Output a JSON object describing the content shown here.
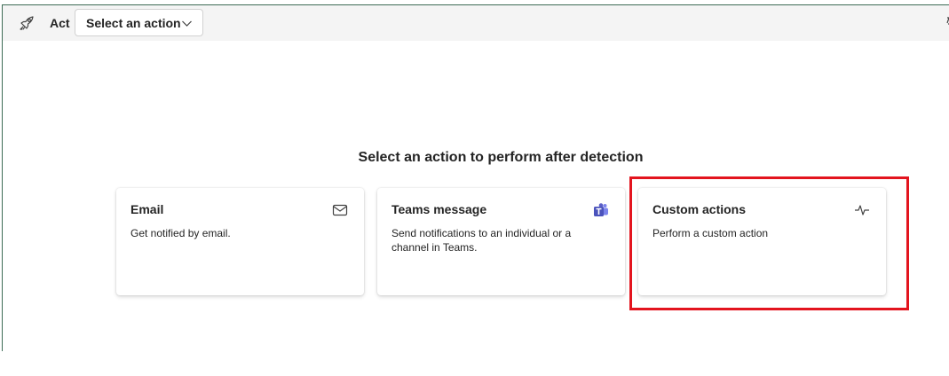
{
  "toolbar": {
    "act_label": "Act",
    "select_value": "Select an action"
  },
  "main": {
    "heading": "Select an action to perform after detection",
    "cards": [
      {
        "title": "Email",
        "description": "Get notified by email.",
        "icon": "mail-icon"
      },
      {
        "title": "Teams message",
        "description": "Send notifications to an individual or a channel in Teams.",
        "icon": "teams-icon"
      },
      {
        "title": "Custom actions",
        "description": "Perform a custom action",
        "icon": "pulse-icon"
      }
    ]
  },
  "colors": {
    "highlight": "#e3141e",
    "teams": "#5b5fc7",
    "toolbar_bg": "#f4f4f4"
  }
}
